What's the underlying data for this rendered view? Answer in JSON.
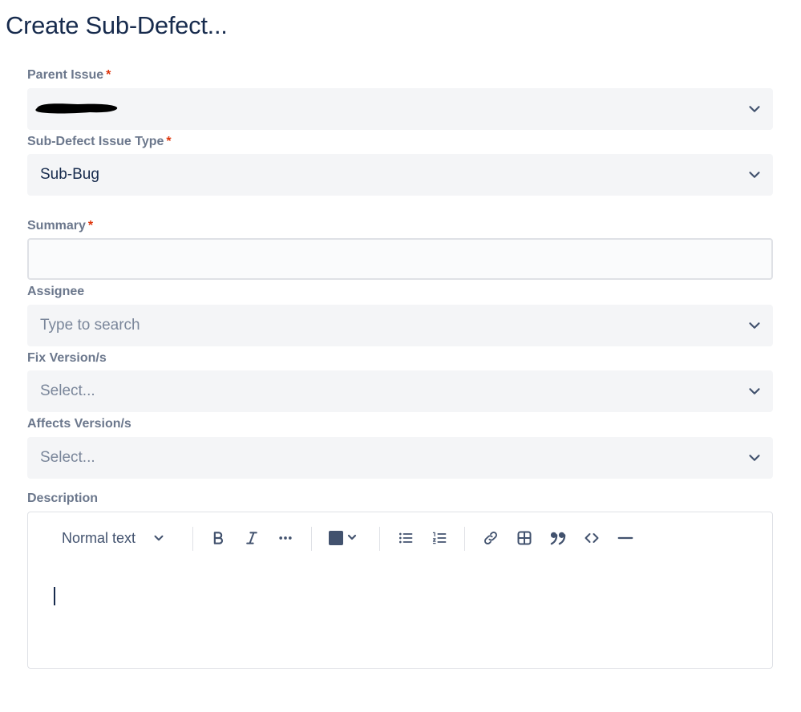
{
  "page": {
    "title": "Create Sub-Defect..."
  },
  "fields": {
    "parent_issue": {
      "label": "Parent Issue",
      "required_marker": "*"
    },
    "issue_type": {
      "label": "Sub-Defect Issue Type",
      "required_marker": "*",
      "value": "Sub-Bug"
    },
    "summary": {
      "label": "Summary",
      "required_marker": "*",
      "value": ""
    },
    "assignee": {
      "label": "Assignee",
      "placeholder": "Type to search"
    },
    "fix_versions": {
      "label": "Fix Version/s",
      "placeholder": "Select..."
    },
    "affects_versions": {
      "label": "Affects Version/s",
      "placeholder": "Select..."
    },
    "description": {
      "label": "Description"
    }
  },
  "editor_toolbar": {
    "text_style": "Normal text",
    "icons": [
      "chevron-down-icon",
      "bold-icon",
      "italic-icon",
      "more-icon",
      "text-color-icon",
      "bullet-list-icon",
      "numbered-list-icon",
      "link-icon",
      "table-icon",
      "quote-icon",
      "code-icon",
      "divider-icon"
    ]
  },
  "colors": {
    "text_primary": "#172b4d",
    "label": "#6b778c",
    "required": "#de350b",
    "field_bg": "#f4f5f7",
    "toolbar_icon": "#42526e",
    "color_swatch": "#42526e"
  }
}
